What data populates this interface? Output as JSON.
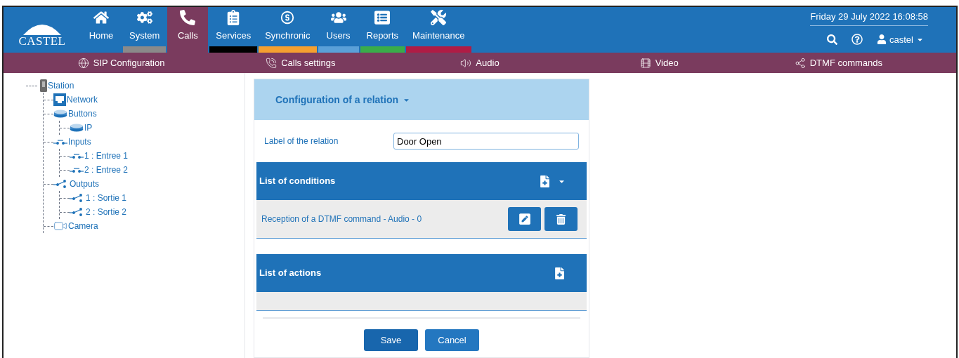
{
  "logo": "CASTEL",
  "nav": [
    {
      "label": "Home",
      "kind": "home",
      "selected": false
    },
    {
      "label": "System",
      "kind": "system",
      "selected": false,
      "color": "#8a8a8a"
    },
    {
      "label": "Calls",
      "kind": "calls",
      "selected": true
    },
    {
      "label": "Services",
      "kind": "services",
      "selected": false,
      "color": "#000000"
    },
    {
      "label": "Synchronic",
      "kind": "synchronic",
      "selected": false,
      "color": "#f5a030"
    },
    {
      "label": "Users",
      "kind": "users",
      "selected": false,
      "color": "#5aa0d8"
    },
    {
      "label": "Reports",
      "kind": "reports",
      "selected": false,
      "color": "#3aac4a"
    },
    {
      "label": "Maintenance",
      "kind": "maintenance",
      "selected": false,
      "color": "#b01c45"
    }
  ],
  "datetime": "Friday 29 July 2022 16:08:58",
  "user": "castel",
  "subnav": [
    {
      "label": "SIP Configuration",
      "kind": "sip"
    },
    {
      "label": "Calls settings",
      "kind": "calls"
    },
    {
      "label": "Audio",
      "kind": "audio"
    },
    {
      "label": "Video",
      "kind": "video"
    },
    {
      "label": "DTMF commands",
      "kind": "dtmf"
    }
  ],
  "tree": [
    {
      "label": "Station",
      "kind": "station",
      "children": [
        {
          "label": "Network",
          "kind": "network"
        },
        {
          "label": "Buttons",
          "kind": "button",
          "children": [
            {
              "label": "IP",
              "kind": "button"
            }
          ]
        },
        {
          "label": "Inputs",
          "kind": "input",
          "children": [
            {
              "label": "1 : Entree 1",
              "kind": "input"
            },
            {
              "label": "2 : Entree 2",
              "kind": "input"
            }
          ]
        },
        {
          "label": "Outputs",
          "kind": "output",
          "children": [
            {
              "label": "1 : Sortie 1",
              "kind": "output"
            },
            {
              "label": "2 : Sortie 2",
              "kind": "output"
            }
          ]
        },
        {
          "label": "Camera",
          "kind": "camera"
        }
      ]
    }
  ],
  "panel": {
    "title": "Configuration of a relation",
    "label_field": {
      "label": "Label of the relation",
      "value": "Door Open"
    },
    "conditions": {
      "title": "List of conditions",
      "rows": [
        "Reception of a DTMF command - Audio - 0"
      ]
    },
    "actions": {
      "title": "List of actions"
    },
    "buttons": [
      "Save",
      "Cancel"
    ]
  }
}
